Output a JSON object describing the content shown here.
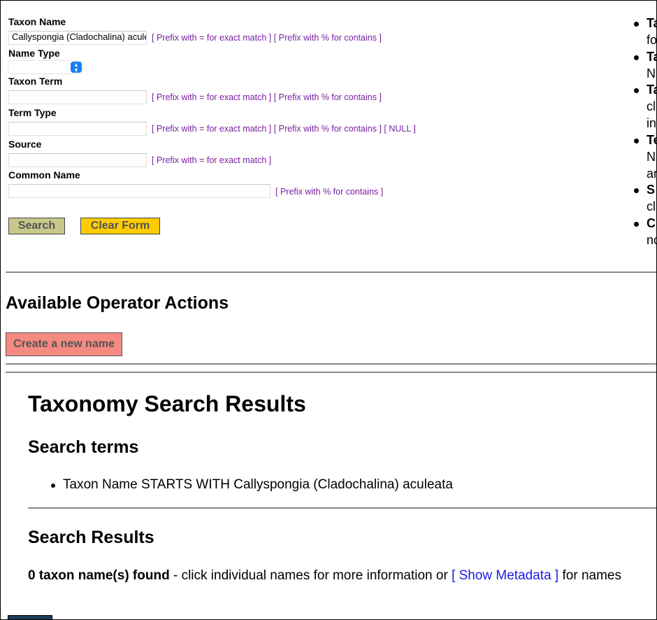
{
  "form": {
    "taxon_name": {
      "label": "Taxon Name",
      "value": "Callyspongia (Cladochalina) aculeata",
      "hint": "[ Prefix with = for exact match ] [ Prefix with % for contains ]"
    },
    "name_type": {
      "label": "Name Type",
      "selected": ""
    },
    "taxon_term": {
      "label": "Taxon Term",
      "value": "",
      "hint": "[ Prefix with = for exact match ] [ Prefix with % for contains ]"
    },
    "term_type": {
      "label": "Term Type",
      "value": "",
      "hint": "[ Prefix with = for exact match ] [ Prefix with % for contains ] [ NULL ]"
    },
    "source": {
      "label": "Source",
      "value": "",
      "hint": "[ Prefix with = for exact match ]"
    },
    "common_name": {
      "label": "Common Name",
      "value": "",
      "hint": "[ Prefix with % for contains ]"
    },
    "search_label": "Search",
    "clear_label": "Clear Form"
  },
  "help_list": [
    {
      "bold": "Ta",
      "text": "fo"
    },
    {
      "bold": "Ta",
      "text": "N"
    },
    {
      "bold": "Ta",
      "text": "cl",
      "text2": "in"
    },
    {
      "bold": "Te",
      "text": "N",
      "text2": "ar"
    },
    {
      "bold": "S",
      "text": "cl"
    },
    {
      "bold": "C",
      "text": "nc"
    }
  ],
  "operator": {
    "heading": "Available Operator Actions",
    "create_label": "Create a new name"
  },
  "results": {
    "title": "Taxonomy Search Results",
    "terms_heading": "Search terms",
    "terms": [
      "Taxon Name STARTS WITH Callyspongia (Cladochalina) aculeata"
    ],
    "results_heading": "Search Results",
    "count_text": "0 taxon name(s) found",
    "after_count": " - click individual names for more information or ",
    "metadata_link": "[ Show Metadata ]",
    "after_link": " for names"
  },
  "colors": {
    "hint": "#7a1fa2",
    "search_btn": "#c8c88a",
    "clear_btn": "#ffcc00",
    "create_btn": "#f48a80",
    "select_accent": "#1a7ef2",
    "link": "#1a1ae6"
  }
}
